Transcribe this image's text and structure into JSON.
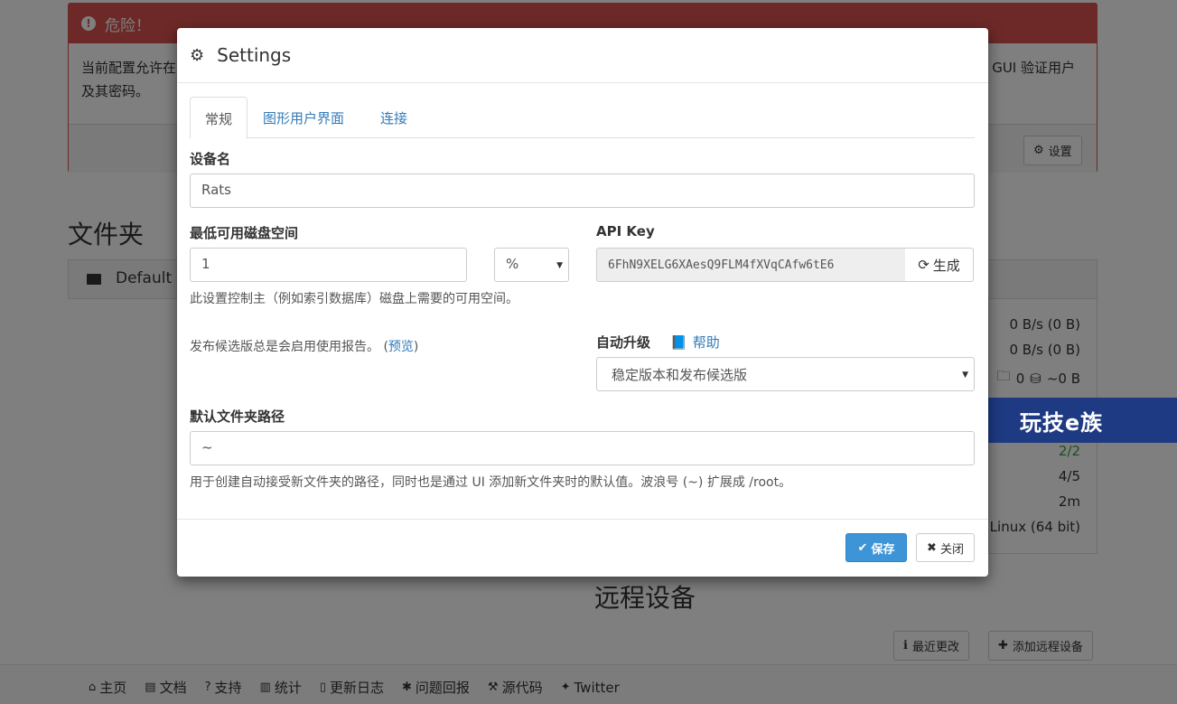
{
  "background": {
    "alert": {
      "title": "危险！",
      "text_line1_left": "当前配置允许在",
      "text_line1_right": "GUI 验证用户",
      "text_line2": "及其密码。",
      "settings_button": "设置"
    },
    "folders_title": "文件夹",
    "folder_default": "Default",
    "devices_title": "远程设备",
    "device_rows": [
      "0 B/s (0 B)",
      "0 B/s (0 B)",
      "~0 B",
      "2/2",
      "4/5",
      "2m",
      ", Linux (64 bit)"
    ],
    "device_folder_count": "0",
    "recent_changes_button": "最近更改",
    "add_device_button": "添加远程设备",
    "footer": [
      "主页",
      "文档",
      "支持",
      "统计",
      "更新日志",
      "问题回报",
      "源代码",
      "Twitter"
    ],
    "watermark": "玩技e族"
  },
  "modal": {
    "title": "Settings",
    "tabs": [
      {
        "label": "常规",
        "active": true
      },
      {
        "label": "图形用户界面",
        "active": false
      },
      {
        "label": "连接",
        "active": false
      }
    ],
    "device_name_label": "设备名",
    "device_name_value": "Rats",
    "min_disk_label": "最低可用磁盘空间",
    "min_disk_value": "1",
    "min_disk_unit": "%",
    "min_disk_help": "此设置控制主（例如索引数据库）磁盘上需要的可用空间。",
    "api_key_label": "API Key",
    "api_key_value": "6FhN9XELG6XAesQ9FLM4fXVqCAfw6tE6",
    "generate_button": "生成",
    "rc_text": "发布候选版总是会启用使用报告。",
    "rc_link": "预览",
    "auto_upgrade_label": "自动升级",
    "help_link": "帮助",
    "auto_upgrade_value": "稳定版本和发布候选版",
    "default_path_label": "默认文件夹路径",
    "default_path_value": "~",
    "default_path_help": "用于创建自动接受新文件夹的路径，同时也是通过 UI 添加新文件夹时的默认值。波浪号 (~) 扩展成 /root。",
    "save_button": "保存",
    "close_button": "关闭"
  },
  "colors": {
    "danger": "#d9534f",
    "primary": "#3d95d8",
    "link": "#337ab7",
    "success": "#3c9a3c"
  }
}
